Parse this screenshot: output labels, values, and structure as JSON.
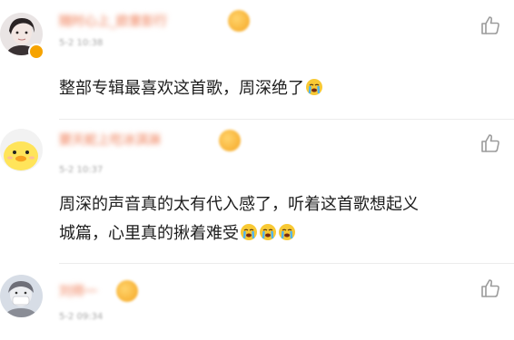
{
  "comments": [
    {
      "username": "随时心上_欧意彭行",
      "timestamp": "5-2 10:38",
      "text": "整部专辑最喜欢这首歌，周深绝了",
      "emoji_count": 1,
      "avatar_icon": "portrait-avatar-icon"
    },
    {
      "username": "要天蛇上吃冰淇淋",
      "timestamp": "5-2 10:37",
      "text_line1": "周深的声音真的太有代入感了，听着这首歌想起义",
      "text_line2": "城篇，心里真的揪着难受",
      "emoji_count": 3,
      "avatar_icon": "yellow-duck-avatar-icon"
    },
    {
      "username": "刘师一",
      "timestamp": "5-2 09:34",
      "avatar_icon": "masked-person-avatar-icon"
    }
  ],
  "colors": {
    "username": "#f4a58a",
    "timestamp": "#a7a7a7",
    "text": "#1d1d1d",
    "icon": "#9b9b9b",
    "verified": "#f6a300"
  },
  "icons": {
    "like": "thumbs-up-icon",
    "emoji": "crying-face-emoji-icon",
    "name_emoji": "smiley-emoji-icon"
  }
}
